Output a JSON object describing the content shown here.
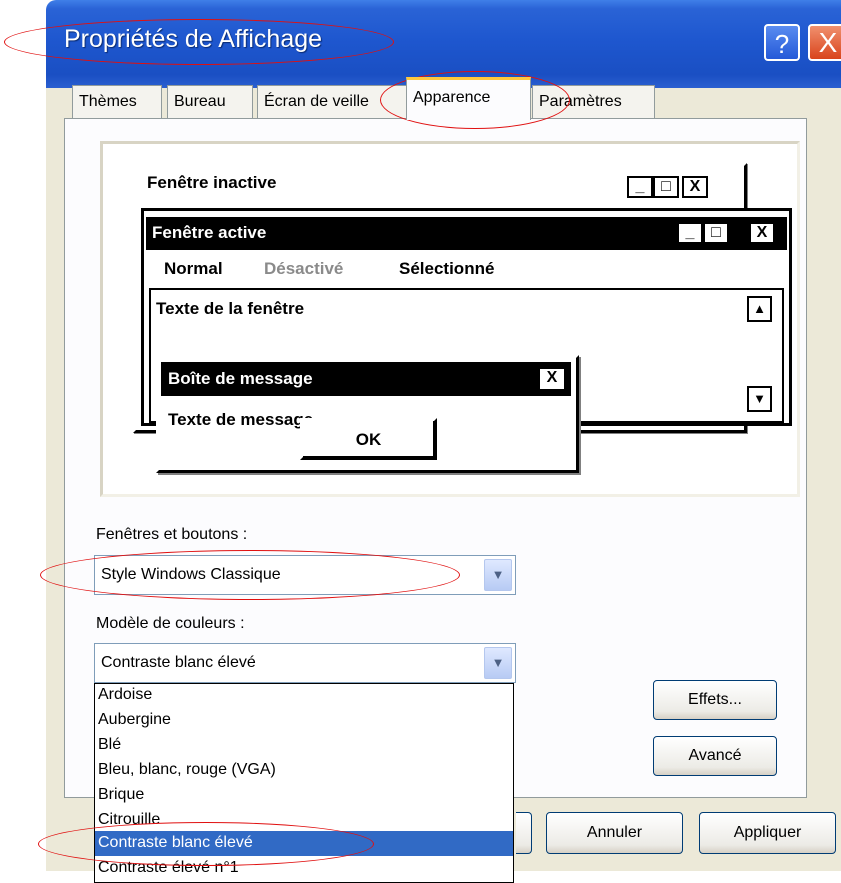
{
  "window": {
    "title": "Propriétés de Affichage",
    "help_glyph": "?",
    "close_glyph": "X"
  },
  "tabs": [
    {
      "label": "Thèmes"
    },
    {
      "label": "Bureau"
    },
    {
      "label": "Écran de veille"
    },
    {
      "label": "Apparence",
      "active": true
    },
    {
      "label": "Paramètres"
    }
  ],
  "preview": {
    "inactive_title": "Fenêtre inactive",
    "active_title": "Fenêtre active",
    "menu_normal": "Normal",
    "menu_disabled": "Désactivé",
    "menu_selected": "Sélectionné",
    "window_text": "Texte de la fenêtre",
    "msgbox_title": "Boîte de message",
    "msgbox_text": "Texte de message",
    "ok_label": "OK",
    "min_glyph": "_",
    "max_glyph": "□",
    "close_glyph": "X",
    "scroll_up_glyph": "▲",
    "scroll_down_glyph": "▼"
  },
  "windows_buttons": {
    "label": "Fenêtres et boutons :",
    "value": "Style Windows Classique"
  },
  "color_scheme": {
    "label": "Modèle de couleurs :",
    "value": "Contraste blanc élevé",
    "options": [
      "Ardoise",
      "Aubergine",
      "Blé",
      "Bleu, blanc, rouge (VGA)",
      "Brique",
      "Citrouille",
      "Contraste blanc élevé",
      "Contraste élevé n°1"
    ],
    "selected_index": 6
  },
  "buttons": {
    "effects": "Effets...",
    "advanced": "Avancé",
    "cancel": "Annuler",
    "apply": "Appliquer"
  },
  "icons": {
    "dropdown": "chevron-down-icon"
  },
  "colors": {
    "titlebar": "#1e57cf",
    "selection": "#316ac5",
    "annotation": "#e01010",
    "tab_highlight": "#ffc83c"
  }
}
